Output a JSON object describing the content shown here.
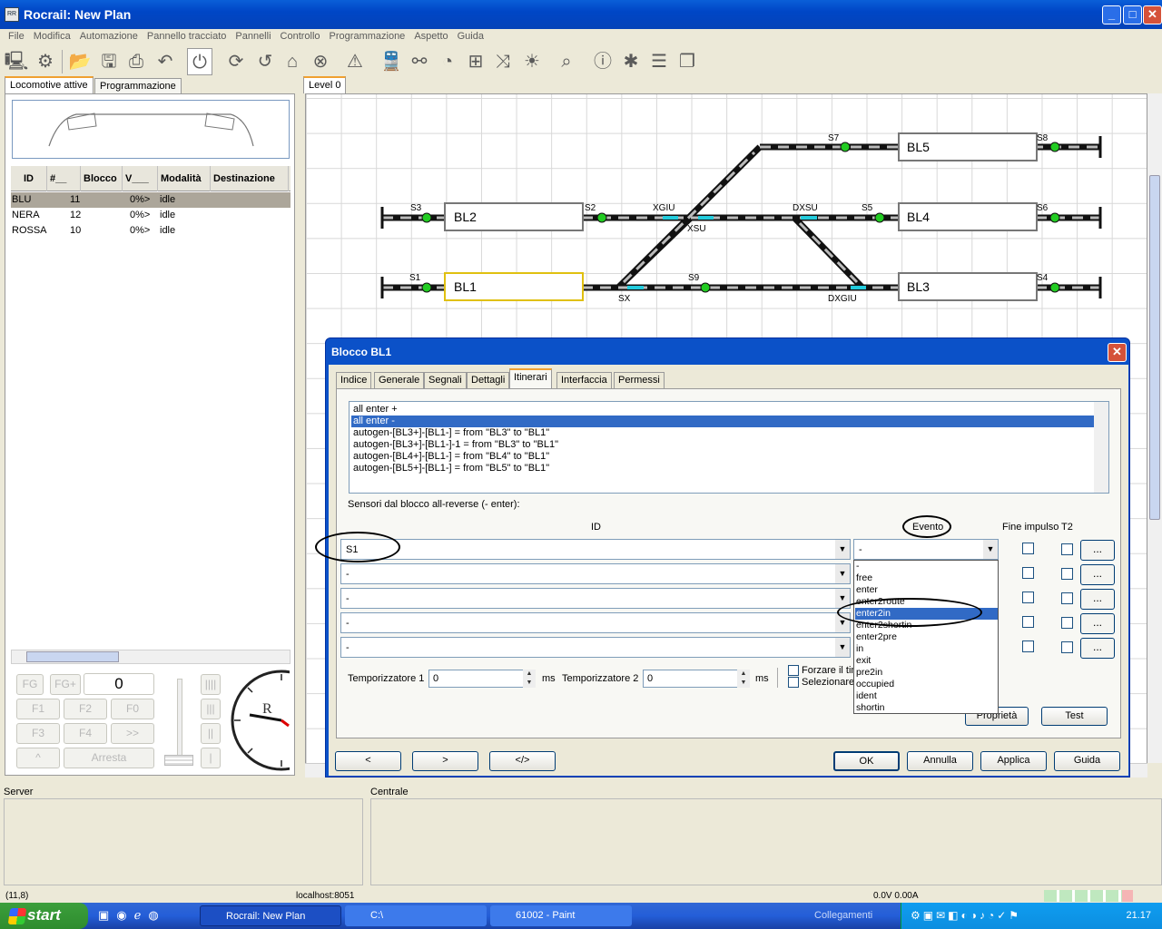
{
  "window": {
    "title": "Rocrail: New Plan",
    "app_icon": "rocrail-app-icon"
  },
  "menu": [
    "File",
    "Modifica",
    "Automazione",
    "Pannello tracciato",
    "Pannelli",
    "Controllo",
    "Programmazione",
    "Aspetto",
    "Guida"
  ],
  "left_tabs": [
    "Locomotive attive",
    "Programmazione"
  ],
  "loco_table": {
    "headers": [
      "ID",
      "#__",
      "Blocco",
      "V___",
      "Modalità",
      "Destinazione"
    ],
    "rows": [
      {
        "id": "BLU",
        "num": "11",
        "block": "",
        "v": "0%>",
        "mode": "idle",
        "dest": ""
      },
      {
        "id": "NERA",
        "num": "12",
        "block": "",
        "v": "0%>",
        "mode": "idle",
        "dest": ""
      },
      {
        "id": "ROSSA",
        "num": "10",
        "block": "",
        "v": "0%>",
        "mode": "idle",
        "dest": ""
      }
    ]
  },
  "controls": {
    "fg": "FG",
    "fgplus": "FG+",
    "speed": "0",
    "f1": "F1",
    "f2": "F2",
    "f0": "F0",
    "f3": "F3",
    "f4": "F4",
    "next": ">>",
    "up": "^",
    "stop": "Arresta",
    "b1": "||||",
    "b2": "|||",
    "b3": "||",
    "b4": "|"
  },
  "plan": {
    "level_tab": "Level 0",
    "blocks": [
      "BL5",
      "BL2",
      "BL4",
      "BL1",
      "BL3"
    ],
    "labels": {
      "s7": "S7",
      "s8": "S8",
      "s3": "S3",
      "s2": "S2",
      "xgiu": "XGIU",
      "xsu": "XSU",
      "dxsu": "DXSU",
      "s5": "S5",
      "s6": "S6",
      "s1": "S1",
      "s9": "S9",
      "s4": "S4",
      "sx": "SX",
      "dxgiu": "DXGIU"
    }
  },
  "dialog": {
    "title": "Blocco BL1",
    "tabs": [
      "Indice",
      "Generale",
      "Segnali",
      "Dettagli",
      "Itinerari",
      "Interfaccia",
      "Permessi"
    ],
    "routes": [
      "all enter +",
      "all enter -",
      "autogen-[BL3+]-[BL1-] = from \"BL3\" to \"BL1\"",
      "autogen-[BL3+]-[BL1-]-1 = from \"BL3\" to \"BL1\"",
      "autogen-[BL4+]-[BL1-] = from \"BL4\" to \"BL1\"",
      "autogen-[BL5+]-[BL1-] = from \"BL5\" to \"BL1\""
    ],
    "sensors_label": "Sensori dal blocco all-reverse (- enter):",
    "col_id": "ID",
    "col_event": "Evento",
    "col_fine": "Fine impulso",
    "col_t2": "T2",
    "sensor_ids": [
      "S1",
      "-",
      "-",
      "-",
      "-"
    ],
    "event_value": "-",
    "dots": "...",
    "timer1_label": "Temporizzatore 1",
    "timer1_value": "0",
    "timer2_label": "Temporizzatore 2",
    "timer2_value": "0",
    "ms": "ms",
    "forzare": "Forzare il tim",
    "selezionare": "Selezionare",
    "proprieta": "Proprietà",
    "test": "Test",
    "nav_prev": "<",
    "nav_next": ">",
    "nav_xml": "</>",
    "ok": "OK",
    "annulla": "Annulla",
    "applica": "Applica",
    "guida": "Guida",
    "event_options": [
      "-",
      "free",
      "enter",
      "enter2route",
      "enter2in",
      "enter2shortin",
      "enter2pre",
      "in",
      "exit",
      "pre2in",
      "occupied",
      "ident",
      "shortin"
    ],
    "event_selected_index": 4
  },
  "bottom": {
    "server": "Server",
    "centrale": "Centrale"
  },
  "status": {
    "coords": "(11,8)",
    "host": "localhost:8051",
    "power": "0.0V 0.00A"
  },
  "taskbar": {
    "start": "start",
    "tasks": [
      "Rocrail: New Plan",
      "C:\\",
      "61002 - Paint"
    ],
    "links": "Collegamenti",
    "time": "21.17"
  },
  "colors": {
    "accent": "#316ac5",
    "title_blue": "#0b51c8",
    "sensor_green": "#22cc22",
    "sensor_cyan": "#22ccdd",
    "selected_block": "#e0c010"
  }
}
